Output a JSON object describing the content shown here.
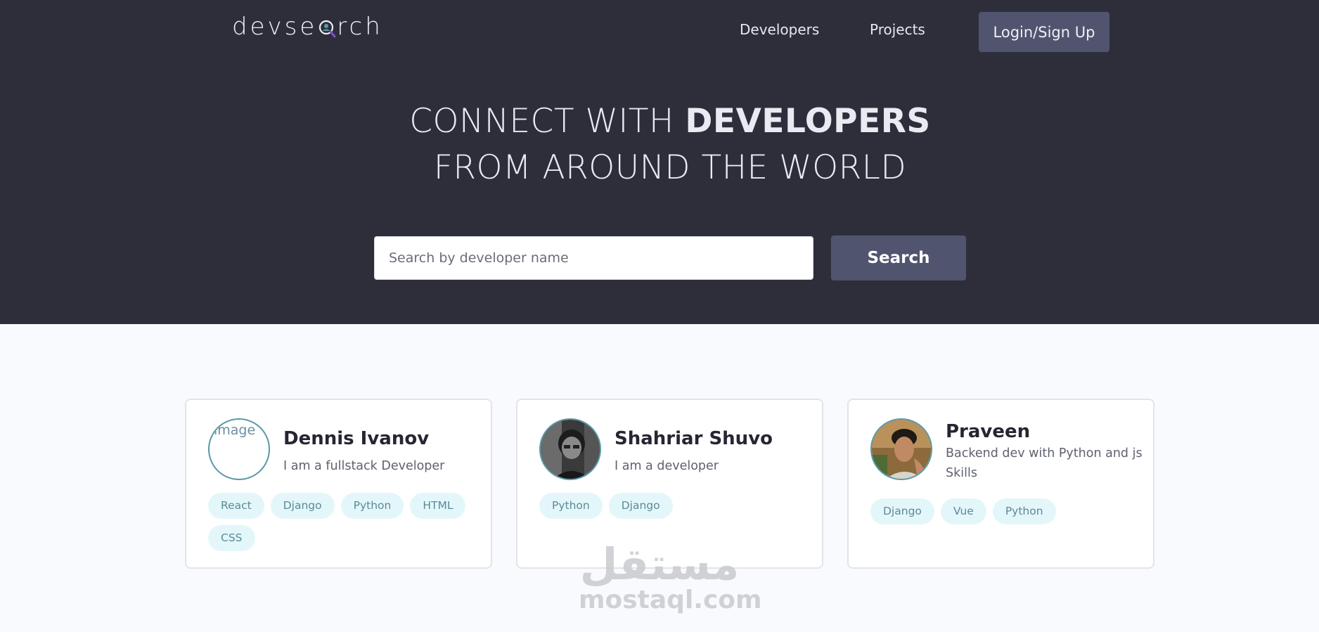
{
  "nav": {
    "logo_pre": "devse",
    "logo_post": "rch",
    "links": [
      "Developers",
      "Projects"
    ],
    "login_label": "Login/Sign Up"
  },
  "hero": {
    "line1_light": "CONNECT WITH ",
    "line1_bold": "DEVELOPERS",
    "line2": "FROM AROUND THE WORLD"
  },
  "search": {
    "placeholder": "Search by developer name",
    "button_label": "Search"
  },
  "developers": [
    {
      "name": "Dennis Ivanov",
      "bio": "I am a fullstack Developer",
      "avatar_alt": "image",
      "tags": [
        "React",
        "Django",
        "Python",
        "HTML",
        "CSS"
      ]
    },
    {
      "name": "Shahriar Shuvo",
      "bio": "I am a developer",
      "tags": [
        "Python",
        "Django"
      ]
    },
    {
      "name": "Praveen",
      "bio": "Backend dev with Python and js Skills",
      "tags": [
        "Django",
        "Vue",
        "Python"
      ]
    }
  ],
  "watermark": {
    "arabic": "مستقل",
    "latin": "mostaql.com"
  },
  "colors": {
    "hero_bg": "#2e2e3b",
    "button_bg": "#51546e",
    "page_bg": "#f8fafd",
    "tag_bg": "#e3f7fb",
    "tag_text": "#5b8a97",
    "avatar_border": "#5a98a8"
  }
}
